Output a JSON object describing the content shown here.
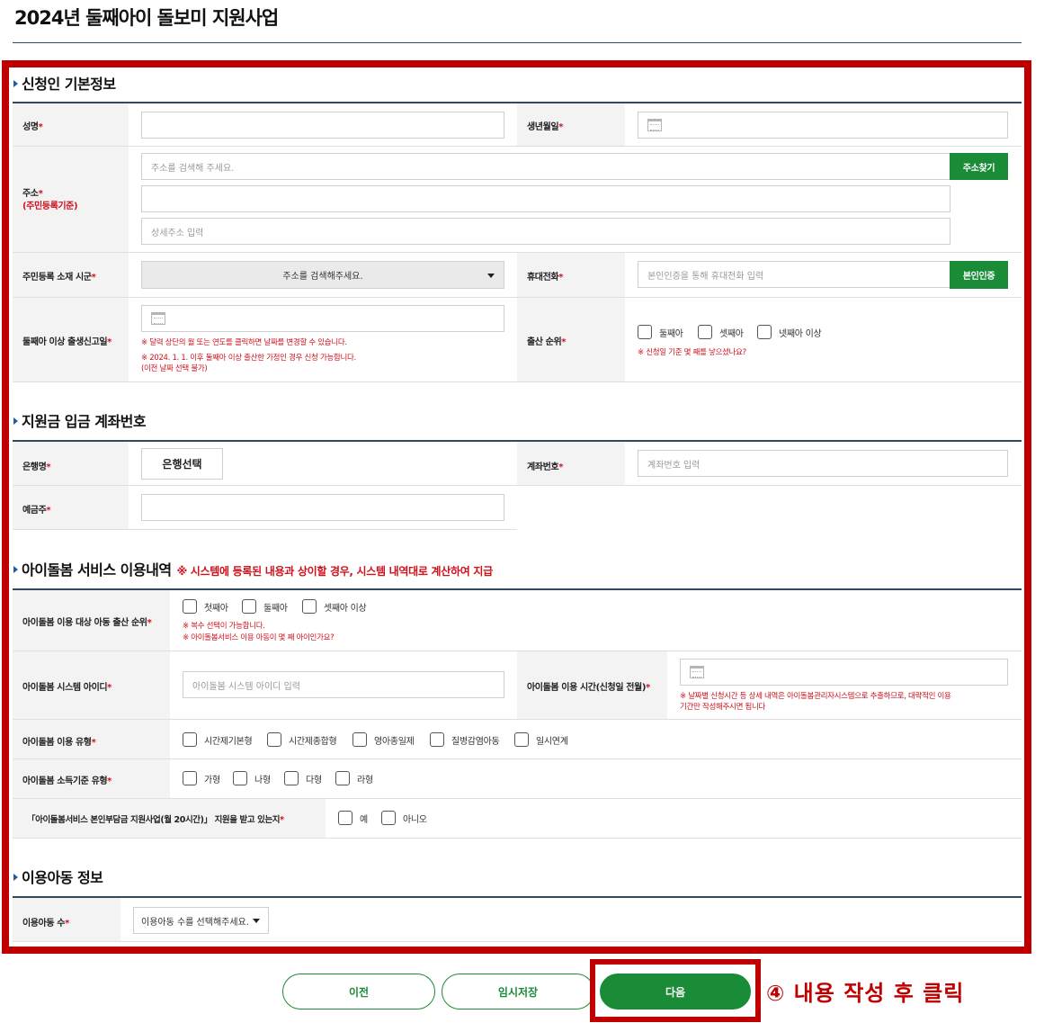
{
  "page": {
    "title": "2024년 둘째아이 돌보미 지원사업"
  },
  "section1": {
    "title": "신청인 기본정보",
    "name_label": "성명",
    "birth_label": "생년월일",
    "address_label": "주소",
    "address_sub": "(주민등록기준)",
    "address_placeholder": "주소를 검색해 주세요.",
    "address_search_btn": "주소찾기",
    "address_detail_placeholder": "상세주소 입력",
    "region_label": "주민등록 소재 시군",
    "region_select": "주소를 검색해주세요.",
    "phone_label": "휴대전화",
    "phone_placeholder": "본인인증을 통해 휴대전화 입력",
    "phone_verify_btn": "본인인증",
    "birth_report_label": "둘째아 이상 출생신고일",
    "birth_report_note1": "※ 달력 상단의 월 또는 연도를 클릭하면 날짜를 변경할 수 있습니다.",
    "birth_report_note2": "※ 2024. 1. 1. 이후 둘째아 이상 출산한 가정인 경우 신청 가능합니다.",
    "birth_report_note3": "(이전 날짜 선택 불가)",
    "birth_order_label": "출산 순위",
    "birth_order_options": [
      "둘째아",
      "셋째아",
      "넷째아 이상"
    ],
    "birth_order_note": "※ 신청일 기준 몇 째를 낳으셨나요?"
  },
  "section2": {
    "title": "지원금 입금 계좌번호",
    "bank_label": "은행명",
    "bank_btn": "은행선택",
    "account_label": "계좌번호",
    "account_placeholder": "계좌번호 입력",
    "holder_label": "예금주"
  },
  "section3": {
    "title": "아이돌봄 서비스 이용내역",
    "note": "※ 시스템에 등록된 내용과 상이할 경우, 시스템 내역대로 계산하여 지급",
    "target_order_label": "아이돌봄 이용 대상 아동 출산 순위",
    "target_order_options": [
      "첫째아",
      "둘째아",
      "셋째아 이상"
    ],
    "target_order_note1": "※ 복수 선택이 가능합니다.",
    "target_order_note2": "※ 아이돌봄서비스 이용 아동이 몇 째 아이인가요?",
    "system_id_label": "아이돌봄 시스템 아이디",
    "system_id_placeholder": "아이돌봄 시스템 아이디 입력",
    "use_time_label": "아이돌봄 이용 시간(신청일 전월)",
    "use_time_note1": "※ 날짜별 신청시간 등 상세 내역은 아이돌봄관리자시스템으로 추출하므로, 대략적인 이용",
    "use_time_note2": "기간만 작성해주시면 됩니다",
    "use_type_label": "아이돌봄 이용 유형",
    "use_type_options": [
      "시간제기본형",
      "시간제종합형",
      "영아종일제",
      "질병감염아동",
      "일시연계"
    ],
    "income_type_label": "아이돌봄 소득기준 유형",
    "income_type_options": [
      "가형",
      "나형",
      "다형",
      "라형"
    ],
    "support_label": "「아이돌봄서비스 본인부담금 지원사업(월 20시간)」 지원을 받고 있는지",
    "support_options": [
      "예",
      "아니오"
    ]
  },
  "section4": {
    "title": "이용아동 정보",
    "child_count_label": "이용아동 수",
    "child_count_select": "이용아동 수를 선택해주세요."
  },
  "required_mark": "*",
  "footer": {
    "prev": "이전",
    "save": "임시저장",
    "next": "다음",
    "callout": "④ 내용 작성 후 클릭"
  },
  "colors": {
    "accent": "#1a8b37",
    "highlight": "#c00000",
    "required": "#d0101b",
    "rule": "#33495e"
  }
}
